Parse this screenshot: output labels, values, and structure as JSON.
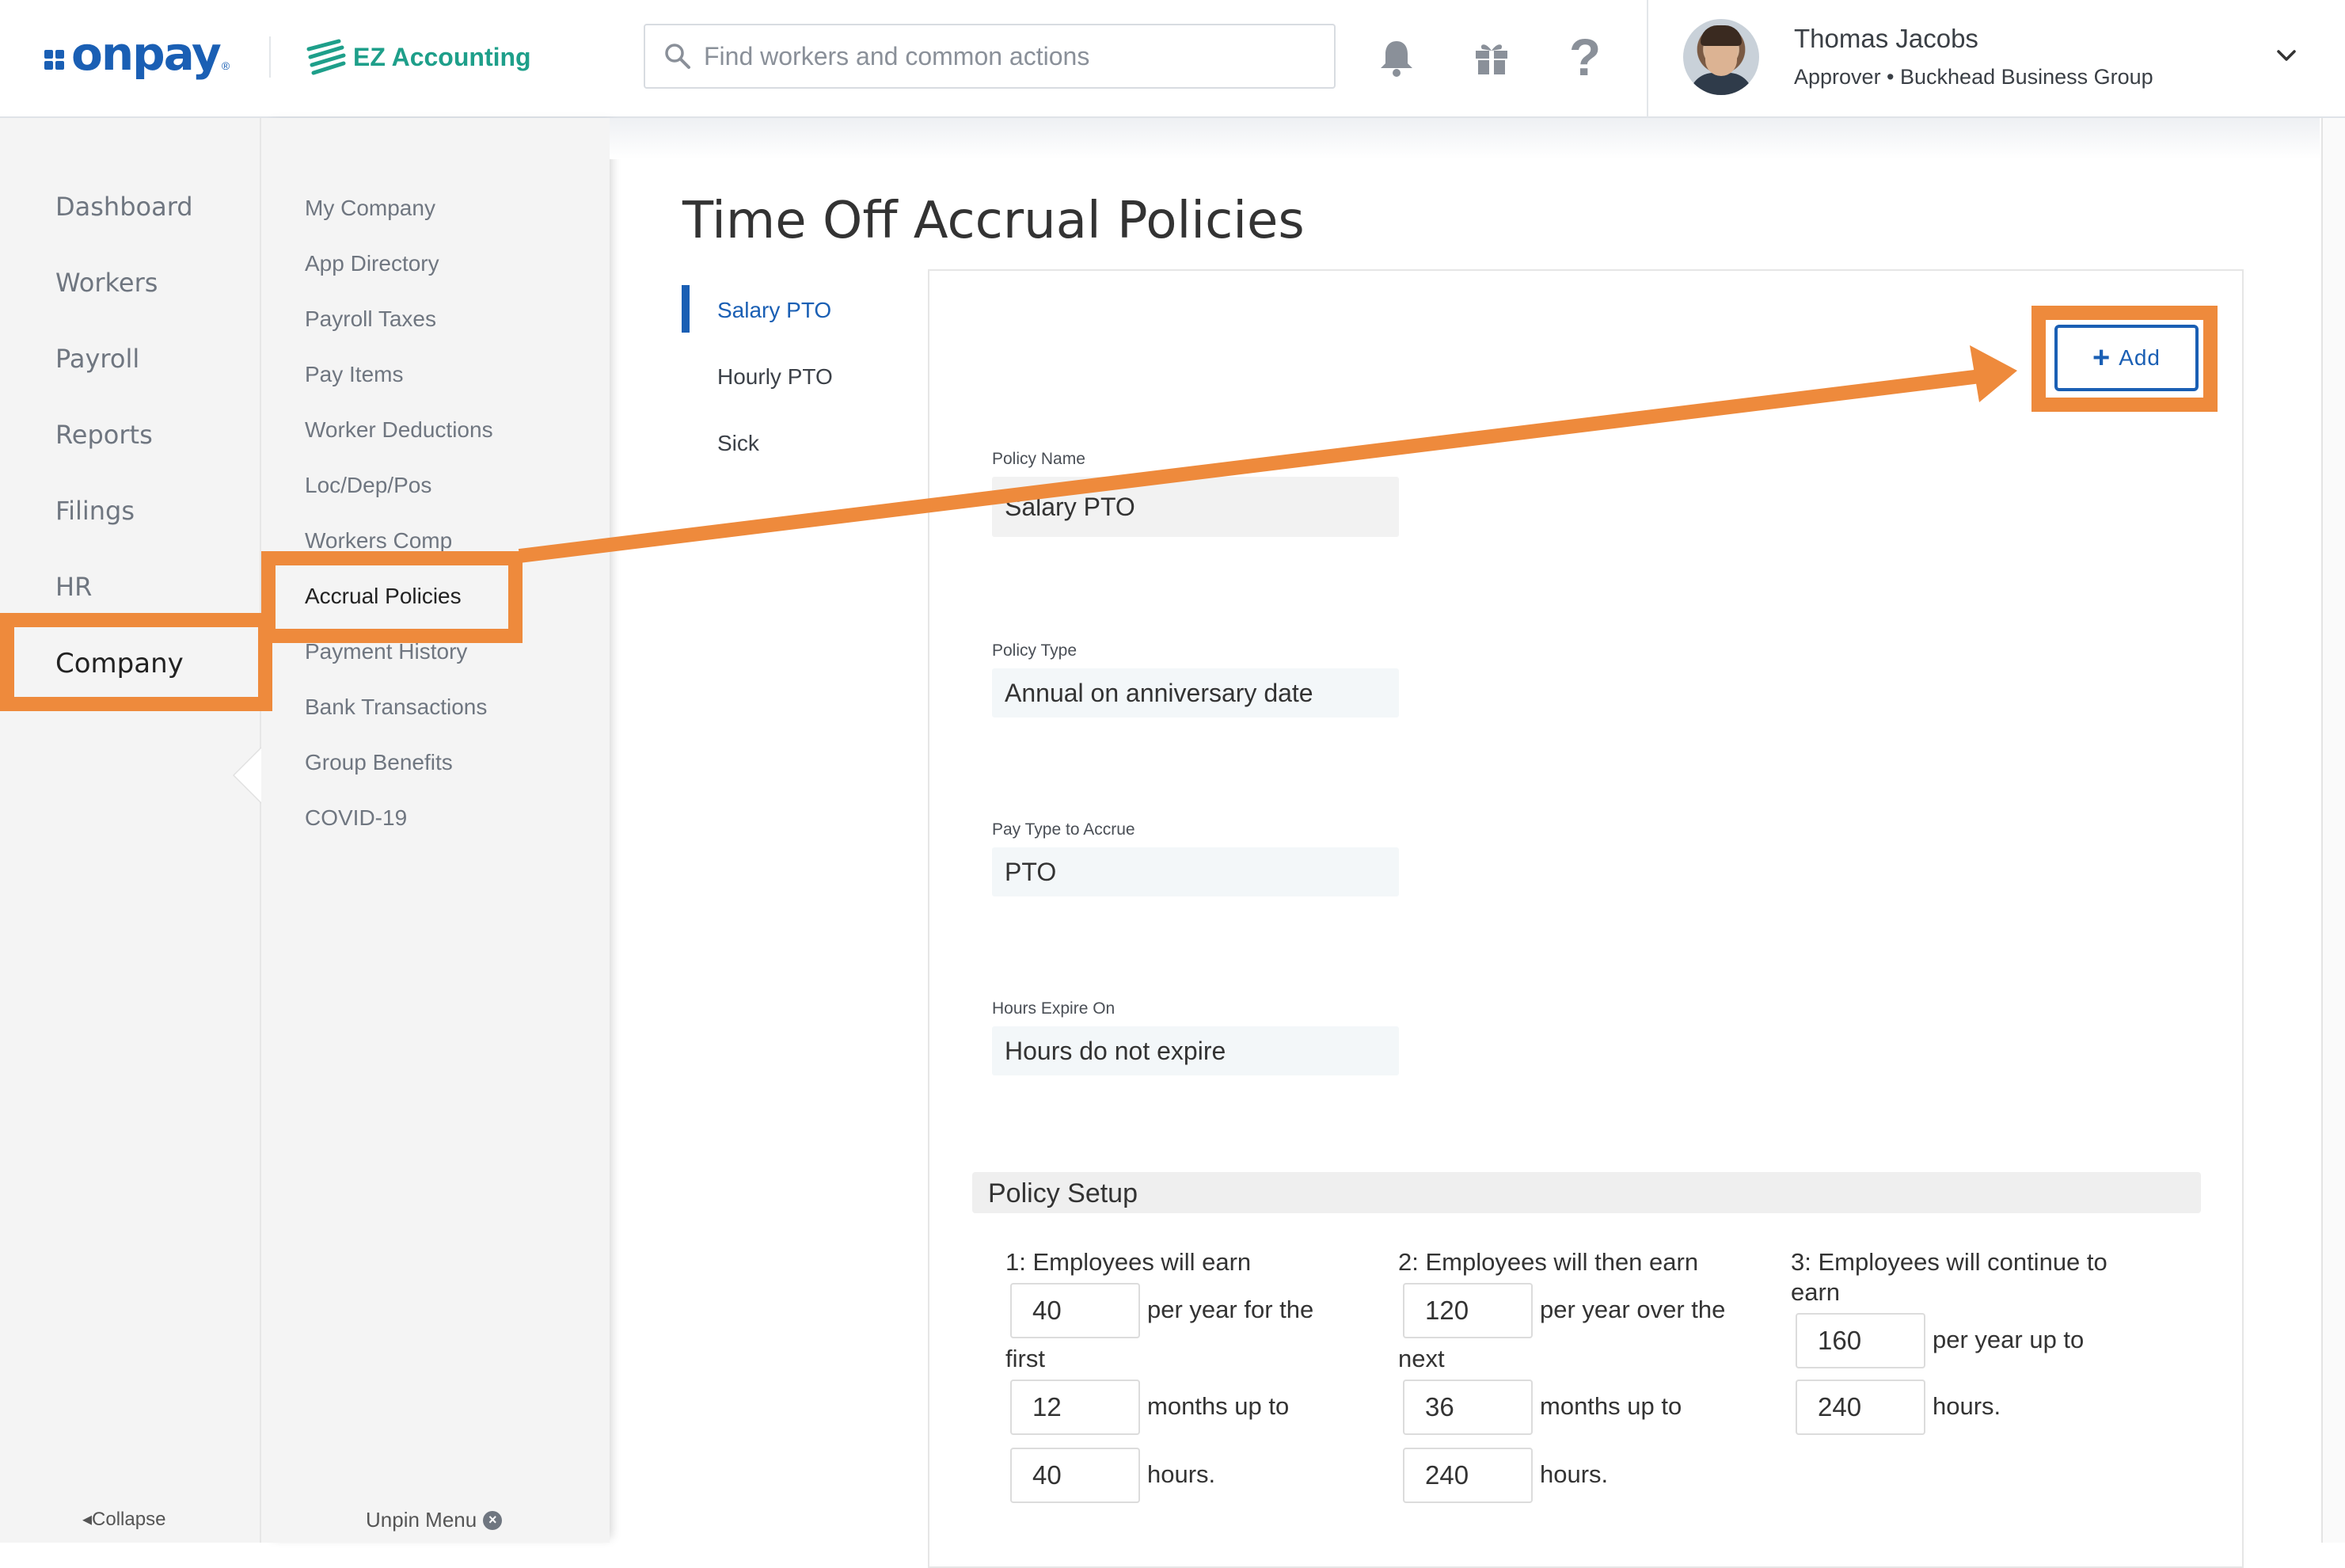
{
  "header": {
    "logo_text": "onpay",
    "logo_reg": "®",
    "partner_logo": "EZ Accounting",
    "search_placeholder": "Find workers and common actions",
    "icons": [
      "bell-icon",
      "gift-icon",
      "help-icon"
    ],
    "help_glyph": "?",
    "user": {
      "name": "Thomas Jacobs",
      "role": "Approver • Buckhead Business Group"
    }
  },
  "primary_nav": {
    "items": [
      "Dashboard",
      "Workers",
      "Payroll",
      "Reports",
      "Filings",
      "HR",
      "Company"
    ],
    "active": "Company",
    "collapse_label": "Collapse"
  },
  "secondary_nav": {
    "items": [
      "My Company",
      "App Directory",
      "Payroll Taxes",
      "Pay Items",
      "Worker Deductions",
      "Loc/Dep/Pos",
      "Workers Comp",
      "Accrual Policies",
      "Payment History",
      "Bank Transactions",
      "Group Benefits",
      "COVID-19"
    ],
    "active": "Accrual Policies",
    "unpin_label": "Unpin Menu"
  },
  "main": {
    "title": "Time Off Accrual Policies",
    "policy_tabs": [
      "Salary PTO",
      "Hourly PTO",
      "Sick"
    ],
    "active_tab": "Salary PTO",
    "add_button": "Add",
    "fields": [
      {
        "label": "Policy Name",
        "value": "Salary PTO"
      },
      {
        "label": "Policy Type",
        "value": "Annual on anniversary date"
      },
      {
        "label": "Pay Type to Accrue",
        "value": "PTO"
      },
      {
        "label": "Hours Expire On",
        "value": "Hours do not expire"
      }
    ],
    "policy_setup": {
      "title": "Policy Setup",
      "tier1": {
        "heading": "1: Employees will earn",
        "rate": "40",
        "rate_suffix": "per year for the",
        "period_word": "first",
        "months": "12",
        "months_suffix": "months up to",
        "cap": "40",
        "cap_suffix": "hours."
      },
      "tier2": {
        "heading": "2: Employees will then earn",
        "rate": "120",
        "rate_suffix": "per year over the",
        "period_word": "next",
        "months": "36",
        "months_suffix": "months up to",
        "cap": "240",
        "cap_suffix": "hours."
      },
      "tier3": {
        "heading_line1": "3: Employees will continue to",
        "heading_line2": "earn",
        "rate": "160",
        "rate_suffix": "per year up to",
        "cap": "240",
        "cap_suffix": "hours."
      }
    }
  },
  "colors": {
    "brand_blue": "#1a5fb4",
    "ez_green": "#1e9f8a",
    "annotation_orange": "#ee8a3c",
    "nav_bg": "#f4f4f4"
  }
}
